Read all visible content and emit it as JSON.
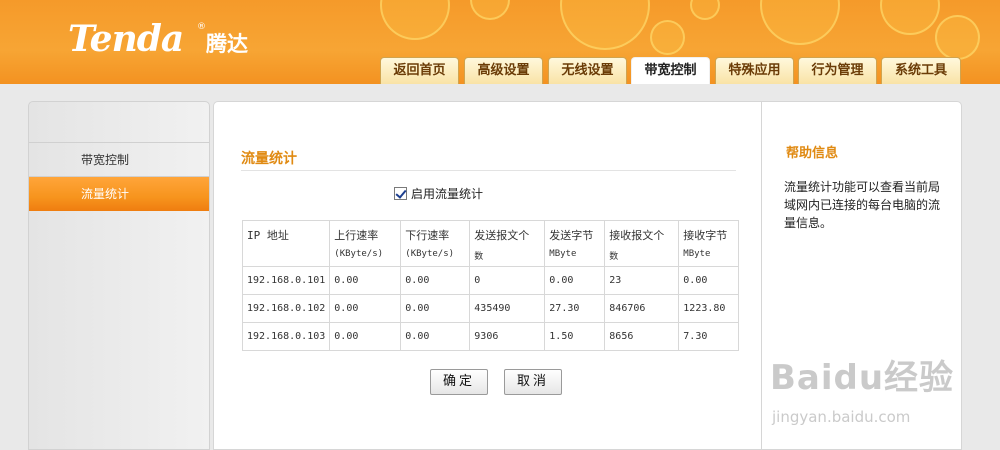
{
  "header": {
    "brand": "Tenda",
    "brand_cn": "腾达",
    "reg_mark": "®",
    "tabs": [
      {
        "label": "返回首页"
      },
      {
        "label": "高级设置"
      },
      {
        "label": "无线设置"
      },
      {
        "label": "带宽控制"
      },
      {
        "label": "特殊应用"
      },
      {
        "label": "行为管理"
      },
      {
        "label": "系统工具"
      }
    ],
    "active_tab": "带宽控制"
  },
  "sidebar": {
    "items": [
      {
        "label": "带宽控制"
      },
      {
        "label": "流量统计"
      }
    ],
    "active_item": "流量统计"
  },
  "main": {
    "title": "流量统计",
    "enable_label": "启用流量统计",
    "enable_checked": true,
    "table": {
      "headers": [
        {
          "main": "IP 地址",
          "sub": ""
        },
        {
          "main": "上行速率",
          "sub": "(KByte/s)"
        },
        {
          "main": "下行速率",
          "sub": "(KByte/s)"
        },
        {
          "main": "发送报文个",
          "sub": "数"
        },
        {
          "main": "发送字节",
          "sub": "MByte"
        },
        {
          "main": "接收报文个",
          "sub": "数"
        },
        {
          "main": "接收字节",
          "sub": "MByte"
        }
      ],
      "rows": [
        [
          "192.168.0.101",
          "0.00",
          "0.00",
          "0",
          "0.00",
          "23",
          "0.00"
        ],
        [
          "192.168.0.102",
          "0.00",
          "0.00",
          "435490",
          "27.30",
          "846706",
          "1223.80"
        ],
        [
          "192.168.0.103",
          "0.00",
          "0.00",
          "9306",
          "1.50",
          "8656",
          "7.30"
        ]
      ]
    },
    "ok_label": "确定",
    "cancel_label": "取消"
  },
  "help": {
    "title": "帮助信息",
    "text": "流量统计功能可以查看当前局域网内已连接的每台电脑的流量信息。"
  },
  "watermark": {
    "main": "Baidu经验",
    "sub": "jingyan.baidu.com"
  },
  "colors": {
    "header_orange": "#f7a534",
    "accent_orange": "#e08a12",
    "active_side": "#f7941d"
  }
}
